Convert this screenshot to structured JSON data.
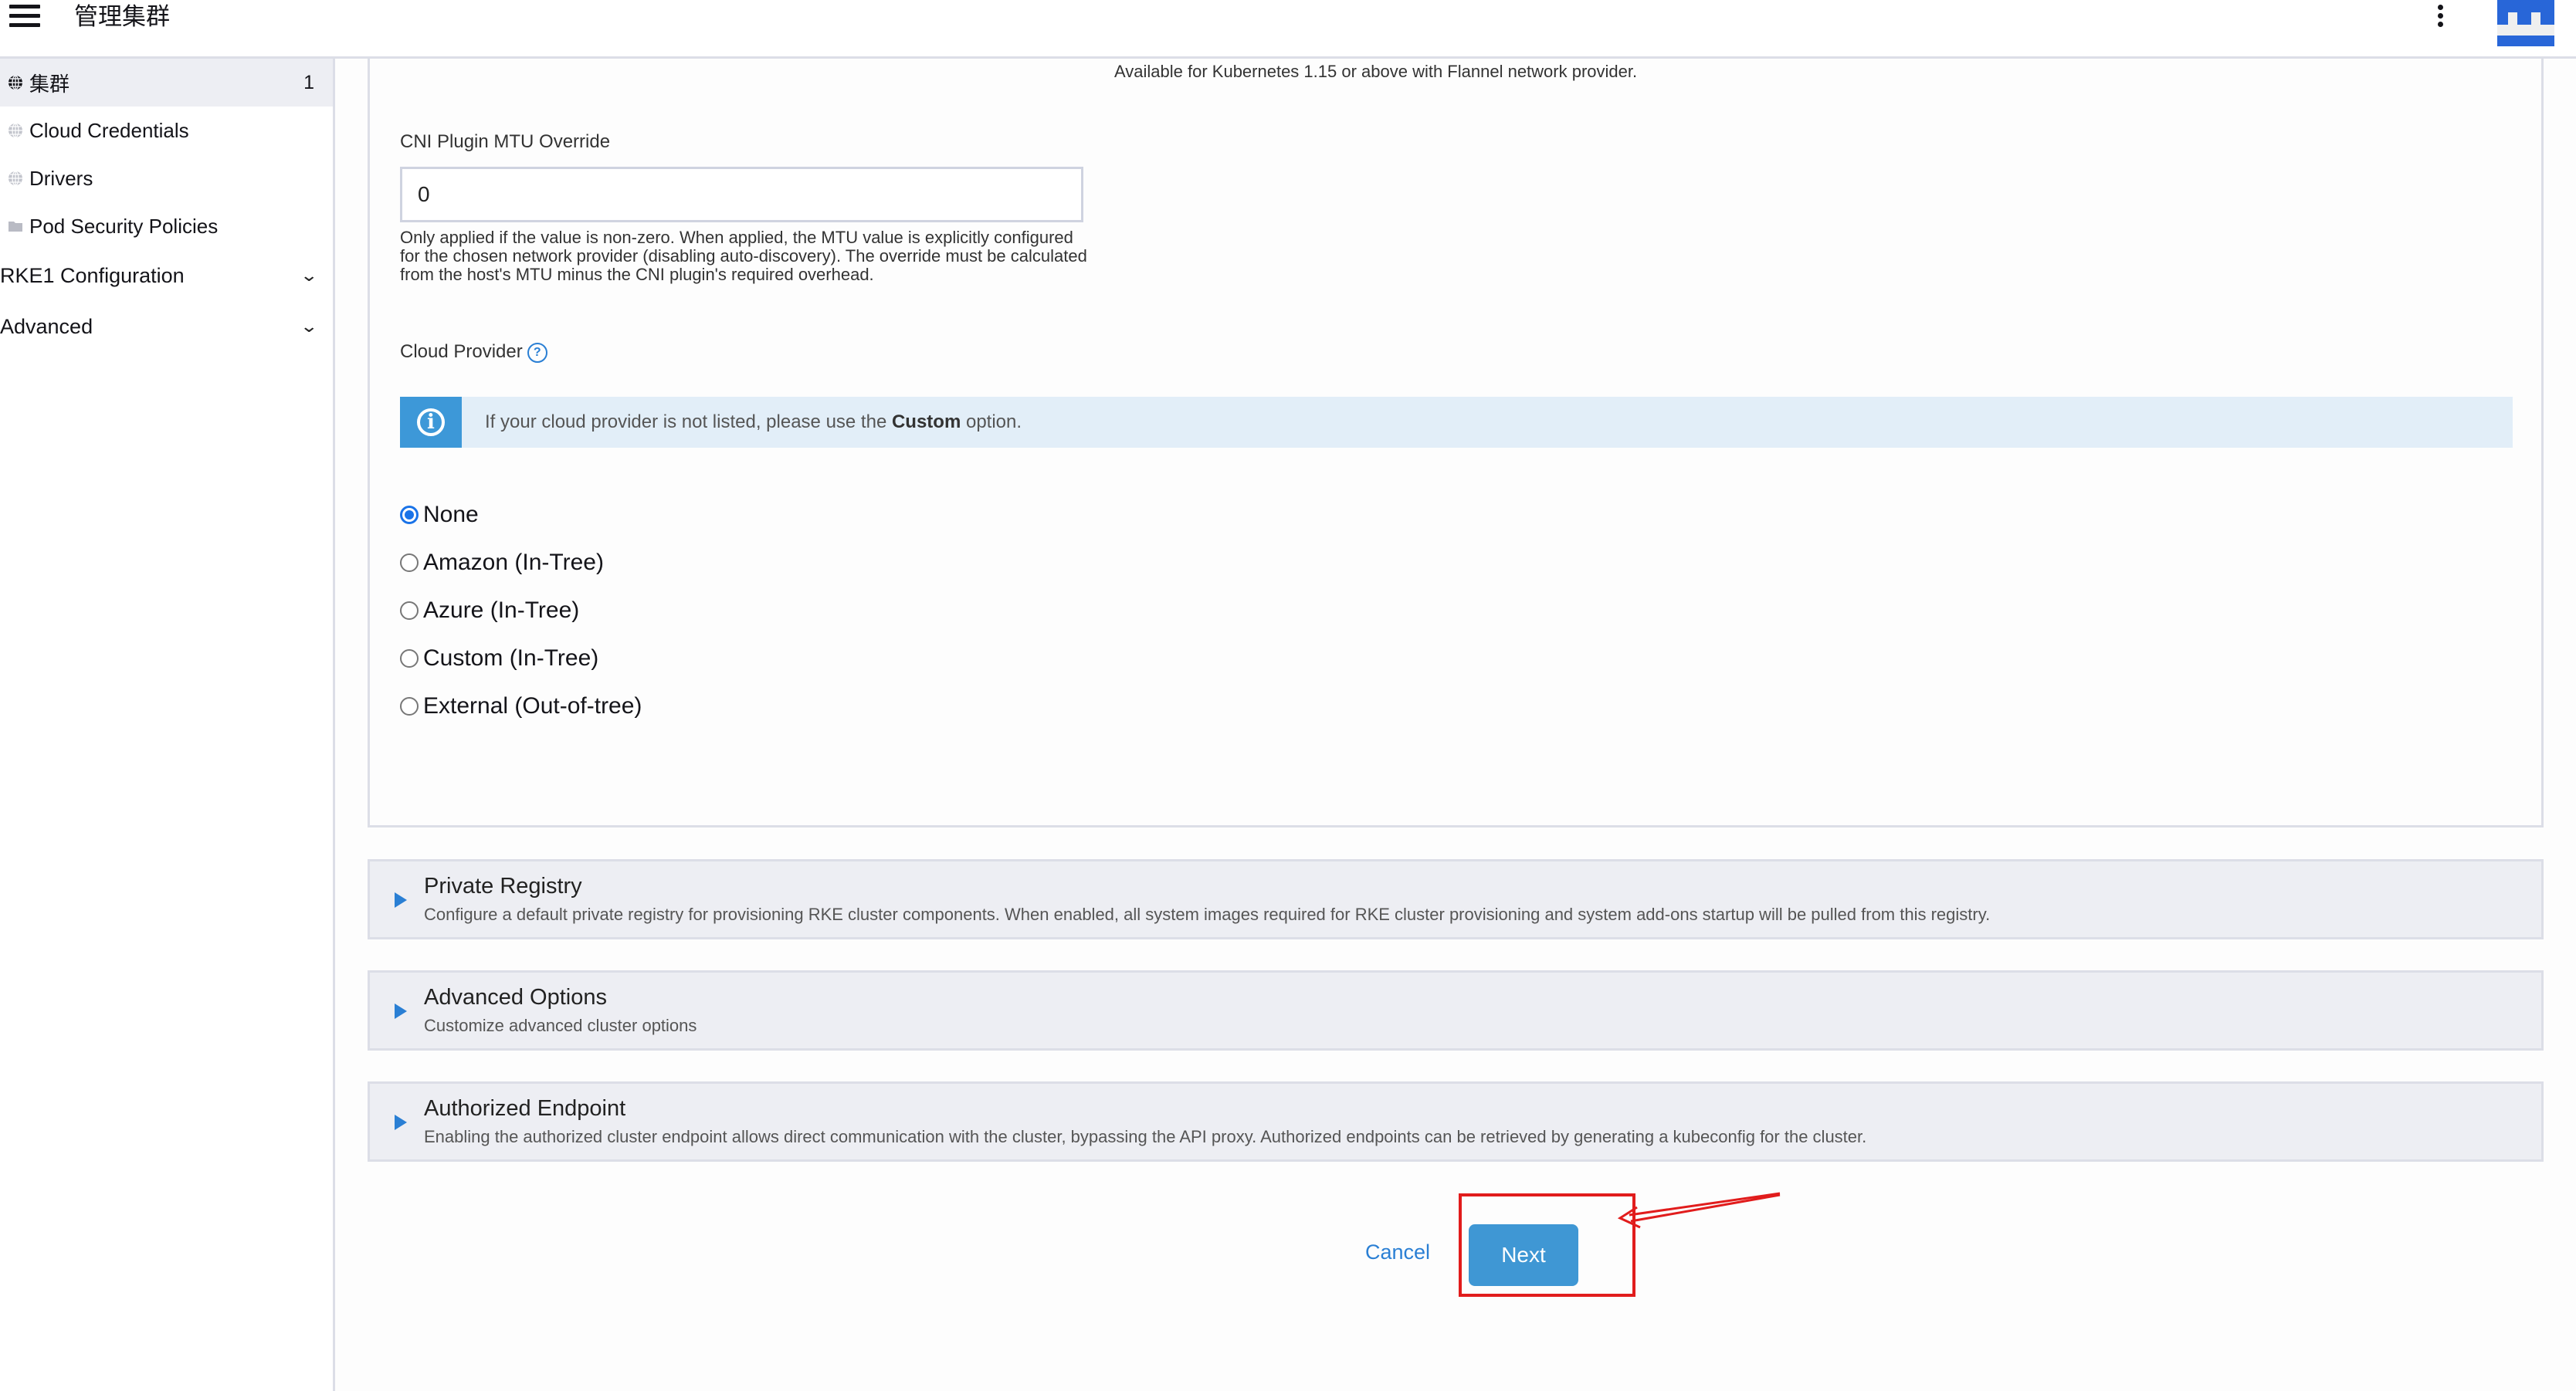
{
  "header": {
    "title": "管理集群",
    "menu_icon": "hamburger-menu-icon",
    "more_icon": "vertical-dots-icon",
    "avatar_icon": "user-identicon-avatar"
  },
  "sidebar": {
    "items": [
      {
        "label": "集群",
        "icon": "globe-icon",
        "count": "1",
        "active": true
      },
      {
        "label": "Cloud Credentials",
        "icon": "globe-icon"
      },
      {
        "label": "Drivers",
        "icon": "globe-icon"
      },
      {
        "label": "Pod Security Policies",
        "icon": "folder-icon"
      }
    ],
    "sections": [
      {
        "label": "RKE1 Configuration",
        "icon": "chevron-down-icon"
      },
      {
        "label": "Advanced",
        "icon": "chevron-down-icon"
      }
    ]
  },
  "form": {
    "flannel_note": "Available for Kubernetes 1.15 or above with Flannel network provider.",
    "mtu": {
      "label": "CNI Plugin MTU Override",
      "value": "0",
      "help": "Only applied if the value is non-zero. When applied, the MTU value is explicitly configured for the chosen network provider (disabling auto-discovery). The override must be calculated from the host's MTU minus the CNI plugin's required overhead."
    },
    "cloud_provider": {
      "label": "Cloud Provider",
      "help_icon": "?",
      "info_icon": "i",
      "info_prefix": "If your cloud provider is not listed, please use the ",
      "info_bold": "Custom",
      "info_suffix": " option.",
      "options": [
        {
          "label": "None",
          "checked": true
        },
        {
          "label": "Amazon (In-Tree)",
          "checked": false
        },
        {
          "label": "Azure (In-Tree)",
          "checked": false
        },
        {
          "label": "Custom (In-Tree)",
          "checked": false
        },
        {
          "label": "External (Out-of-tree)",
          "checked": false
        }
      ]
    }
  },
  "accordions": [
    {
      "title": "Private Registry",
      "description": "Configure a default private registry for provisioning RKE cluster components. When enabled, all system images required for RKE cluster provisioning and system add-ons startup will be pulled from this registry."
    },
    {
      "title": "Advanced Options",
      "description": "Customize advanced cluster options"
    },
    {
      "title": "Authorized Endpoint",
      "description": "Enabling the authorized cluster endpoint allows direct communication with the cluster, bypassing the API proxy. Authorized endpoints can be retrieved by generating a kubeconfig for the cluster."
    }
  ],
  "actions": {
    "cancel_label": "Cancel",
    "next_label": "Next"
  },
  "colors": {
    "accent": "#3f97d4",
    "link": "#2a7fd4",
    "radio_checked": "#1a73e8",
    "info_banner_bg": "#e2eef8",
    "annotation": "#e11c1c",
    "avatar": "#2866d8"
  }
}
